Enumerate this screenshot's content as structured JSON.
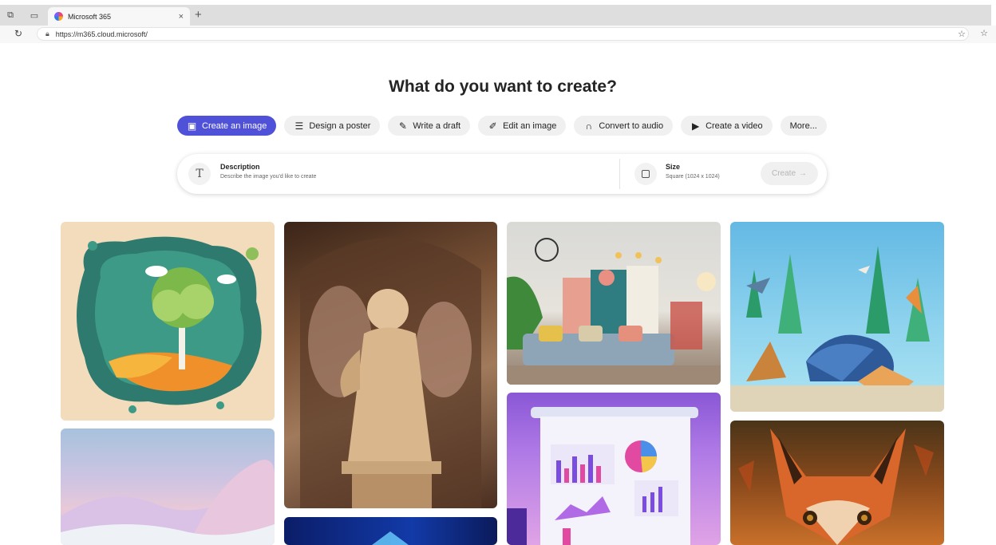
{
  "browser": {
    "tab_title": "Microsoft 365",
    "tab_close": "×",
    "new_tab": "+",
    "url": "https://m365.cloud.microsoft/"
  },
  "page": {
    "heading": "What do you want to create?"
  },
  "actions": [
    {
      "label": "Create an image",
      "icon": "image-icon",
      "glyph": "🖼",
      "active": true
    },
    {
      "label": "Design a poster",
      "icon": "poster-icon",
      "glyph": "☰",
      "active": false
    },
    {
      "label": "Write a draft",
      "icon": "pen-icon",
      "glyph": "✎",
      "active": false
    },
    {
      "label": "Edit an image",
      "icon": "edit-image-icon",
      "glyph": "✐",
      "active": false
    },
    {
      "label": "Convert to audio",
      "icon": "headphones-icon",
      "glyph": "🎧",
      "active": false
    },
    {
      "label": "Create a video",
      "icon": "video-icon",
      "glyph": "▶",
      "active": false
    },
    {
      "label": "More...",
      "icon": "",
      "glyph": "",
      "active": false
    }
  ],
  "prompt": {
    "description_label": "Description",
    "description_hint": "Describe the image you'd like to create",
    "description_glyph": "T",
    "size_label": "Size",
    "size_value": "Square (1024 x 1024)",
    "create_label": "Create",
    "create_arrow": "→"
  },
  "colors": {
    "accent": "#4f52d9",
    "chip_bg": "#f0f0f0"
  }
}
